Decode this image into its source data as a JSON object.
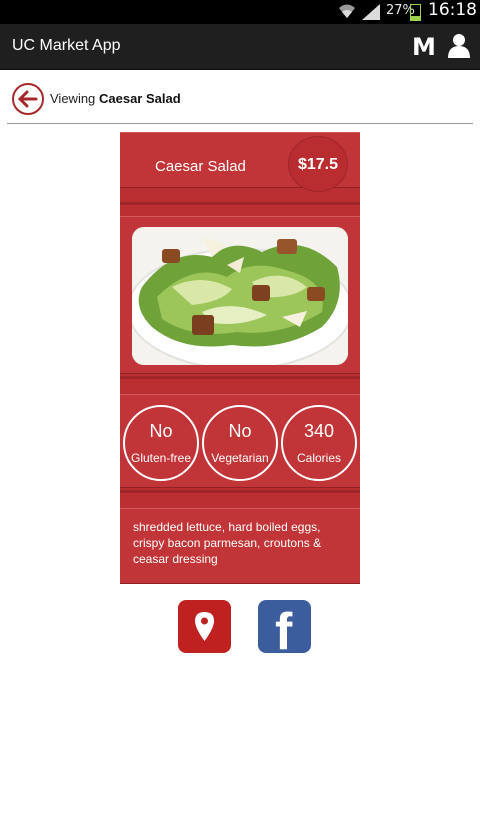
{
  "status_bar": {
    "battery_pct": "27%",
    "battery_level": 0.27,
    "time": "16:18"
  },
  "app_bar": {
    "title": "UC Market App",
    "m_icon": "M",
    "icons": [
      "m-icon",
      "user-icon"
    ]
  },
  "breadcrumb": {
    "prefix": "Viewing",
    "item": "Caesar Salad",
    "back_icon": "back-arrow-icon"
  },
  "item": {
    "name": "Caesar Salad",
    "price": "$17.5",
    "image": "caesar-salad-photo",
    "facts": [
      {
        "value": "No",
        "label": "Gluten-free"
      },
      {
        "value": "No",
        "label": "Vegetarian"
      },
      {
        "value": "340",
        "label": "Calories"
      }
    ],
    "description": "shredded lettuce, hard boiled eggs, crispy bacon parmesan, croutons & ceasar dressing"
  },
  "actions": {
    "map_icon": "map-pin-icon",
    "facebook_label": "f"
  },
  "colors": {
    "card_red": "#bb2f32",
    "accent_red": "#a4282c",
    "facebook_blue": "#3b5d9c",
    "map_red": "#bf2121",
    "action_bar": "#1f1f1f"
  }
}
